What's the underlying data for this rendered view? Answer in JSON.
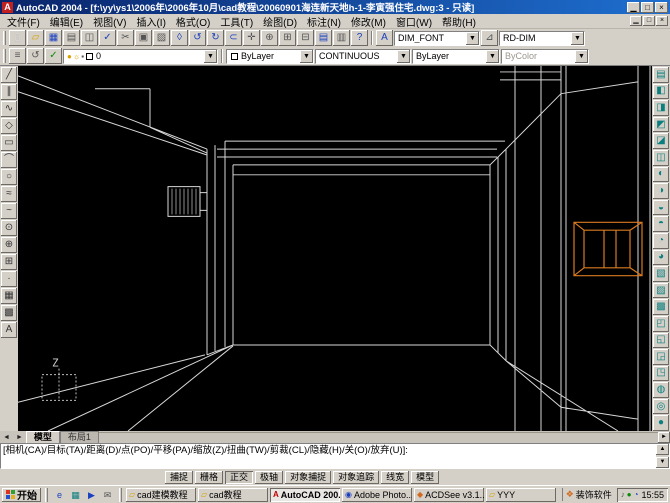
{
  "window": {
    "title": "AutoCAD 2004 - [f:\\yy\\ys1\\2006年\\2006年10月\\cad教程\\20060901海连新天地h-1-李寅强住宅.dwg:3 - 只读]",
    "controls": {
      "minimize": "▁",
      "maximize": "□",
      "close": "×"
    }
  },
  "menu": {
    "items": [
      "文件(F)",
      "编辑(E)",
      "视图(V)",
      "插入(I)",
      "格式(O)",
      "工具(T)",
      "绘图(D)",
      "标注(N)",
      "修改(M)",
      "窗口(W)",
      "帮助(H)"
    ],
    "mdi_controls": {
      "minimize": "▁",
      "restore": "□",
      "close": "×"
    }
  },
  "icons": {
    "dropdown": "▼",
    "scroll_up": "▲",
    "scroll_down": "▼",
    "tab_left": "◄",
    "tab_right": "►"
  },
  "toolbar_standard": {
    "icons": [
      {
        "name": "new-icon",
        "glyph": "▯",
        "cls": "c-white"
      },
      {
        "name": "open-icon",
        "glyph": "▱",
        "cls": "c-yellow"
      },
      {
        "name": "save-icon",
        "glyph": "▦",
        "cls": "c-blue"
      },
      {
        "name": "print-icon",
        "glyph": "▤",
        "cls": "c-gray"
      },
      {
        "name": "print-preview-icon",
        "glyph": "◫",
        "cls": "c-gray"
      },
      {
        "name": "spelling-icon",
        "glyph": "✓",
        "cls": "c-blue"
      },
      {
        "name": "cut-icon",
        "glyph": "✂",
        "cls": "c-gray"
      },
      {
        "name": "copy-icon",
        "glyph": "▣",
        "cls": "c-gray"
      },
      {
        "name": "paste-icon",
        "glyph": "▨",
        "cls": "c-gray"
      },
      {
        "name": "match-properties-icon",
        "glyph": "◊",
        "cls": "c-blue"
      },
      {
        "name": "undo-icon",
        "glyph": "↺",
        "cls": "c-blue"
      },
      {
        "name": "redo-icon",
        "glyph": "↻",
        "cls": "c-blue"
      },
      {
        "name": "insert-hyperlink-icon",
        "glyph": "⊂",
        "cls": "c-blue"
      },
      {
        "name": "pan-realtime-icon",
        "glyph": "✛",
        "cls": "c-gray"
      },
      {
        "name": "zoom-realtime-icon",
        "glyph": "⊕",
        "cls": "c-gray"
      },
      {
        "name": "zoom-window-icon",
        "glyph": "⊞",
        "cls": "c-gray"
      },
      {
        "name": "zoom-previous-icon",
        "glyph": "⊟",
        "cls": "c-gray"
      },
      {
        "name": "properties-icon",
        "glyph": "▤",
        "cls": "c-blue"
      },
      {
        "name": "designcenter-icon",
        "glyph": "▥",
        "cls": "c-gray"
      },
      {
        "name": "help-icon",
        "glyph": "?",
        "cls": "c-blue"
      }
    ]
  },
  "toolbar_styles": {
    "text_style_icon": "A",
    "text_style_value": "DIM_FONT",
    "dim_style_icon": "⊿",
    "dim_style_value": "RD-DIM"
  },
  "toolbar_layers": {
    "icons": [
      {
        "name": "layers-icon",
        "glyph": "≡",
        "cls": "c-gray"
      },
      {
        "name": "layer-previous-icon",
        "glyph": "↺",
        "cls": "c-gray"
      },
      {
        "name": "make-current-icon",
        "glyph": "✓",
        "cls": "c-green"
      }
    ],
    "status_icons": [
      {
        "name": "layer-on-icon",
        "glyph": "●",
        "cls": "c-yellow"
      },
      {
        "name": "layer-thaw-icon",
        "glyph": "☼",
        "cls": "c-yellow"
      },
      {
        "name": "layer-unlock-icon",
        "glyph": "▪",
        "cls": "c-gray"
      }
    ],
    "current_layer": "0"
  },
  "toolbar_properties": {
    "color_value": "ByLayer",
    "linetype_value": "CONTINUOUS",
    "lineweight_value": "ByLayer",
    "plotstyle_value": "ByColor"
  },
  "left_toolbar": {
    "icons": [
      {
        "name": "line-icon",
        "glyph": "╱"
      },
      {
        "name": "construction-line-icon",
        "glyph": "∥"
      },
      {
        "name": "polyline-icon",
        "glyph": "∿"
      },
      {
        "name": "polygon-icon",
        "glyph": "◇"
      },
      {
        "name": "rectangle-icon",
        "glyph": "▭"
      },
      {
        "name": "arc-icon",
        "glyph": "⌒"
      },
      {
        "name": "circle-icon",
        "glyph": "○"
      },
      {
        "name": "revision-cloud-icon",
        "glyph": "≈"
      },
      {
        "name": "spline-icon",
        "glyph": "~"
      },
      {
        "name": "ellipse-icon",
        "glyph": "⊙"
      },
      {
        "name": "insert-block-icon",
        "glyph": "⊕"
      },
      {
        "name": "make-block-icon",
        "glyph": "⊞"
      },
      {
        "name": "point-icon",
        "glyph": "·"
      },
      {
        "name": "hatch-icon",
        "glyph": "▦"
      },
      {
        "name": "region-icon",
        "glyph": "▩"
      },
      {
        "name": "mtext-icon",
        "glyph": "A"
      }
    ]
  },
  "right_toolbar": {
    "icons": [
      {
        "name": "named-views-icon",
        "glyph": "▤"
      },
      {
        "name": "top-view-icon",
        "glyph": "◧"
      },
      {
        "name": "bottom-view-icon",
        "glyph": "◨"
      },
      {
        "name": "left-view-icon",
        "glyph": "◩"
      },
      {
        "name": "right-view-icon",
        "glyph": "◪"
      },
      {
        "name": "front-view-icon",
        "glyph": "◫"
      },
      {
        "name": "back-view-icon",
        "glyph": "◐"
      },
      {
        "name": "sw-isometric-icon",
        "glyph": "◑"
      },
      {
        "name": "se-isometric-icon",
        "glyph": "◒"
      },
      {
        "name": "ne-isometric-icon",
        "glyph": "◓"
      },
      {
        "name": "nw-isometric-icon",
        "glyph": "◔"
      },
      {
        "name": "camera-icon",
        "glyph": "◕"
      },
      {
        "name": "pan-3d-icon",
        "glyph": "▧"
      },
      {
        "name": "zoom-3d-icon",
        "glyph": "▨"
      },
      {
        "name": "orbit-3d-icon",
        "glyph": "▩"
      },
      {
        "name": "continuous-orbit-icon",
        "glyph": "◰"
      },
      {
        "name": "swivel-3d-icon",
        "glyph": "◱"
      },
      {
        "name": "adjust-distance-icon",
        "glyph": "◲"
      },
      {
        "name": "adjust-clip-icon",
        "glyph": "◳"
      },
      {
        "name": "wireframe-2d-icon",
        "glyph": "◍"
      },
      {
        "name": "hidden-view-icon",
        "glyph": "◎"
      },
      {
        "name": "gouraud-shaded-icon",
        "glyph": "●"
      }
    ]
  },
  "tabs": {
    "items": [
      {
        "label": "模型",
        "state": "active"
      },
      {
        "label": "布局1"
      }
    ]
  },
  "command": {
    "prompt": "[相机(CA)/目标(TA)/距离(D)/点(PO)/平移(PA)/缩放(Z)/扭曲(TW)/剪裁(CL)/隐藏(H)/关(O)/放弃(U)]:"
  },
  "statusbar": {
    "buttons": [
      {
        "label": "捕捉"
      },
      {
        "label": "栅格"
      },
      {
        "label": "正交",
        "state": "pressed"
      },
      {
        "label": "极轴"
      },
      {
        "label": "对象捕捉"
      },
      {
        "label": "对象追踪"
      },
      {
        "label": "线宽"
      },
      {
        "label": "模型"
      }
    ]
  },
  "taskbar": {
    "start_label": "开始",
    "quicklaunch": [
      {
        "name": "ie-icon",
        "glyph": "e",
        "cls": "c-blue"
      },
      {
        "name": "desktop-icon",
        "glyph": "▦",
        "cls": "c-teal"
      },
      {
        "name": "media-player-icon",
        "glyph": "▶",
        "cls": "c-blue"
      },
      {
        "name": "mail-icon",
        "glyph": "✉",
        "cls": "c-gray"
      }
    ],
    "tasks": [
      {
        "label": "cad建模教程",
        "icon": "▱",
        "iconcls": "c-yellow"
      },
      {
        "label": "cad教程",
        "icon": "▱",
        "iconcls": "c-yellow"
      },
      {
        "label": "AutoCAD 200...",
        "icon": "A",
        "iconcls": "c-red",
        "state": "active"
      },
      {
        "label": "Adobe Photo...",
        "icon": "◉",
        "iconcls": "c-blue"
      },
      {
        "label": "ACDSee v3.1...",
        "icon": "◆",
        "iconcls": "c-orange"
      },
      {
        "label": "YYY",
        "icon": "▱",
        "iconcls": "c-yellow"
      }
    ],
    "band": {
      "icon": "❖",
      "label": "装饰软件"
    },
    "tray": {
      "icons": [
        {
          "name": "volume-icon",
          "glyph": "♪",
          "cls": "c-gray"
        },
        {
          "name": "antivirus-icon",
          "glyph": "●",
          "cls": "c-green"
        },
        {
          "name": "scheduler-icon",
          "glyph": "◔",
          "cls": "c-blue"
        }
      ],
      "clock": "15:55"
    }
  },
  "ucs": {
    "z_label": "Z"
  },
  "colors": {
    "canvas_bg": "#000000",
    "wireframe": "#d8d8d8",
    "wireframe_dim": "#8c8c8c",
    "highlight": "#d97a1f",
    "chrome": "#d4d0c8",
    "titlebar_left": "#0a246a",
    "titlebar_right": "#1e6fd0"
  }
}
